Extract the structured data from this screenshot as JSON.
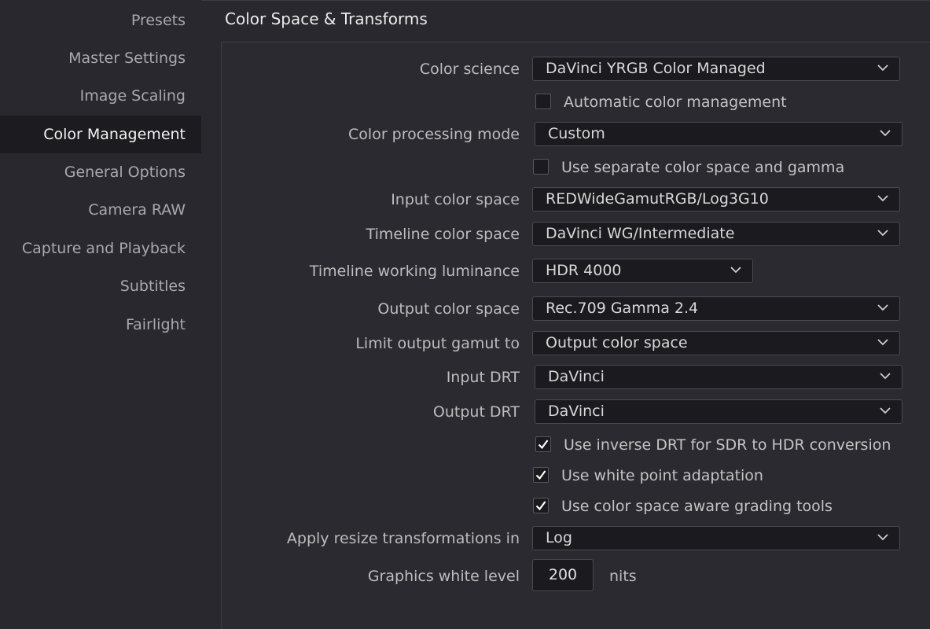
{
  "sidebar": {
    "items": [
      {
        "label": "Presets"
      },
      {
        "label": "Master Settings"
      },
      {
        "label": "Image Scaling"
      },
      {
        "label": "Color Management",
        "active": true
      },
      {
        "label": "General Options"
      },
      {
        "label": "Camera RAW"
      },
      {
        "label": "Capture and Playback"
      },
      {
        "label": "Subtitles"
      },
      {
        "label": "Fairlight"
      }
    ]
  },
  "section": {
    "title": "Color Space & Transforms"
  },
  "fields": {
    "color_science": {
      "label": "Color science",
      "value": "DaVinci YRGB Color Managed"
    },
    "auto_color_mgmt": {
      "label": "Automatic color management",
      "checked": false
    },
    "color_processing_mode": {
      "label": "Color processing mode",
      "value": "Custom"
    },
    "separate_cs_gamma": {
      "label": "Use separate color space and gamma",
      "checked": false
    },
    "input_color_space": {
      "label": "Input color space",
      "value": "REDWideGamutRGB/Log3G10"
    },
    "timeline_color_space": {
      "label": "Timeline color space",
      "value": "DaVinci WG/Intermediate"
    },
    "timeline_working_luminance": {
      "label": "Timeline working luminance",
      "value": "HDR 4000"
    },
    "output_color_space": {
      "label": "Output color space",
      "value": "Rec.709 Gamma 2.4"
    },
    "limit_output_gamut": {
      "label": "Limit output gamut to",
      "value": "Output color space"
    },
    "input_drt": {
      "label": "Input DRT",
      "value": "DaVinci"
    },
    "output_drt": {
      "label": "Output DRT",
      "value": "DaVinci"
    },
    "inverse_drt": {
      "label": "Use inverse DRT for SDR to HDR conversion",
      "checked": true
    },
    "white_point_adapt": {
      "label": "Use white point adaptation",
      "checked": true
    },
    "cs_aware_grading": {
      "label": "Use color space aware grading tools",
      "checked": true
    },
    "apply_resize": {
      "label": "Apply resize transformations in",
      "value": "Log"
    },
    "graphics_white_level": {
      "label": "Graphics white level",
      "value": "200",
      "unit": "nits"
    }
  },
  "colors": {
    "background": "#28282e",
    "field_bg": "#1b1b1f",
    "active_sidebar_bg": "#1c1c20"
  },
  "icons": {
    "dropdown": "chevron-down-icon",
    "check": "checkmark-icon"
  }
}
